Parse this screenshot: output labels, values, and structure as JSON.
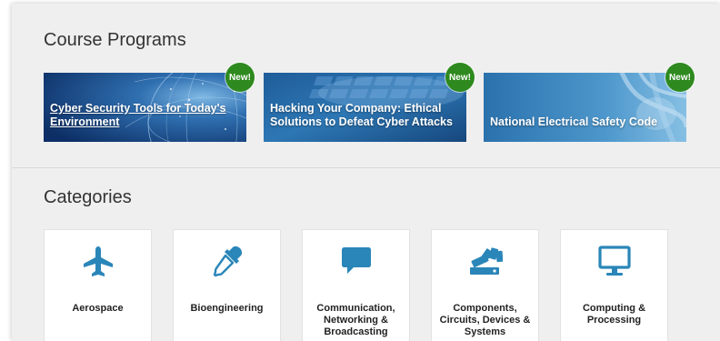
{
  "sections": {
    "programs_title": "Course Programs",
    "categories_title": "Categories"
  },
  "programs": [
    {
      "title": "Cyber Security Tools for Today's Environment",
      "badge": "New!"
    },
    {
      "title": "Hacking Your Company: Ethical Solutions to Defeat Cyber Attacks",
      "badge": "New!"
    },
    {
      "title": "National Electrical Safety Code",
      "badge": "New!"
    }
  ],
  "categories": [
    {
      "label": "Aerospace",
      "icon": "airplane-icon"
    },
    {
      "label": "Bioengineering",
      "icon": "dropper-icon"
    },
    {
      "label": "Communication, Networking & Broadcasting",
      "icon": "speech-bubble-icon"
    },
    {
      "label": "Components, Circuits, Devices & Systems",
      "icon": "components-icon"
    },
    {
      "label": "Computing & Processing",
      "icon": "monitor-icon"
    }
  ],
  "colors": {
    "accent_blue": "#2a86b8",
    "badge_green": "#2e8a1e",
    "panel_bg": "#efefef"
  }
}
